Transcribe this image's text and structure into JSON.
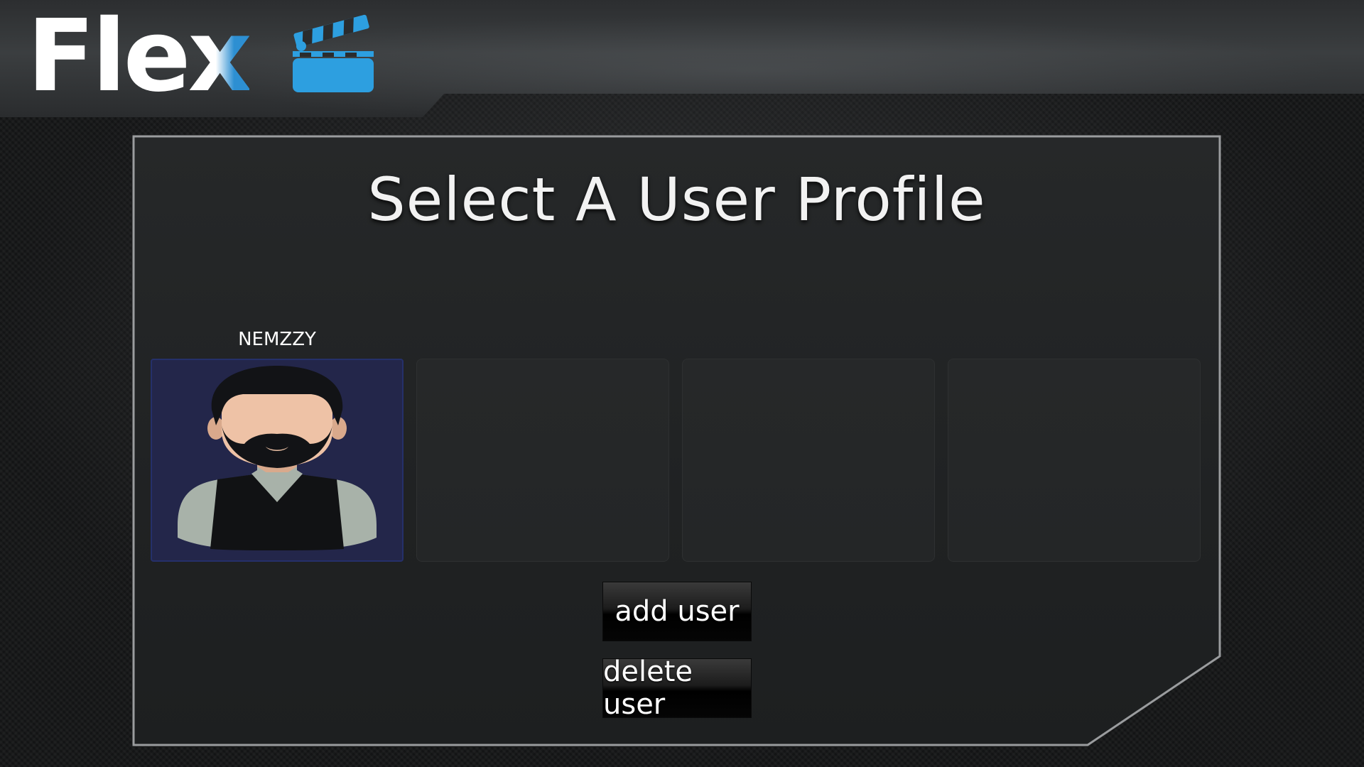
{
  "app": {
    "logo_text_main": "Fle",
    "logo_text_accent": "x",
    "accent_color": "#2d8fd2"
  },
  "header": {
    "icon": "clapperboard-icon"
  },
  "main": {
    "title": "Select A User Profile",
    "profiles": [
      {
        "name": "NEMZZY",
        "avatar": "bearded-man-avatar",
        "selected": true
      },
      {
        "name": "",
        "avatar": "",
        "selected": false
      },
      {
        "name": "",
        "avatar": "",
        "selected": false
      },
      {
        "name": "",
        "avatar": "",
        "selected": false
      }
    ],
    "buttons": {
      "add_label": "add user",
      "delete_label": "delete user"
    }
  }
}
